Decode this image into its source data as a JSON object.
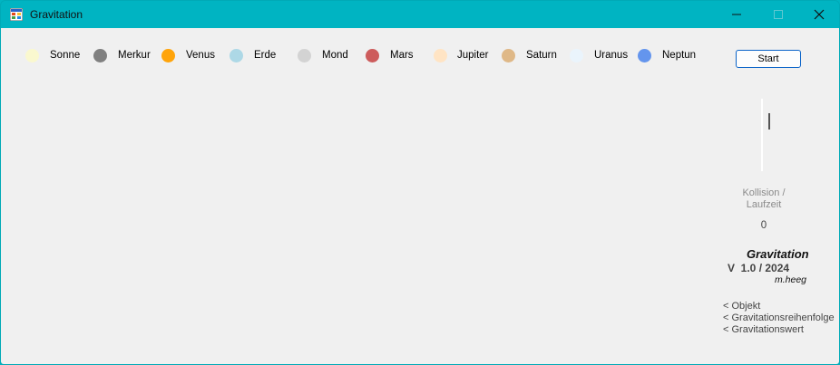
{
  "window": {
    "title": "Gravitation",
    "minimize_icon": "minimize-icon",
    "maximize_icon": "maximize-icon",
    "close_icon": "close-icon"
  },
  "legend": [
    {
      "label": "Sonne",
      "color": "#faf8cf"
    },
    {
      "label": "Merkur",
      "color": "#808080"
    },
    {
      "label": "Venus",
      "color": "#ffa40a"
    },
    {
      "label": "Erde",
      "color": "#add8e6"
    },
    {
      "label": "Mond",
      "color": "#d3d3d3"
    },
    {
      "label": "Mars",
      "color": "#cd5c5c"
    },
    {
      "label": "Jupiter",
      "color": "#ffe4c4"
    },
    {
      "label": "Saturn",
      "color": "#dfb887"
    },
    {
      "label": "Uranus",
      "color": "#eaf4fc"
    },
    {
      "label": "Neptun",
      "color": "#6495ed"
    }
  ],
  "controls": {
    "start_label": "Start",
    "kollision_label": "Kollision / Laufzeit",
    "runtime_value": "0"
  },
  "branding": {
    "title": "Gravitation",
    "version": "V  1.0 / 2024",
    "author": "m.heeg"
  },
  "hints": [
    "<  Objekt",
    "<  Gravitationsreihenfolge",
    "<  Gravitationswert"
  ]
}
